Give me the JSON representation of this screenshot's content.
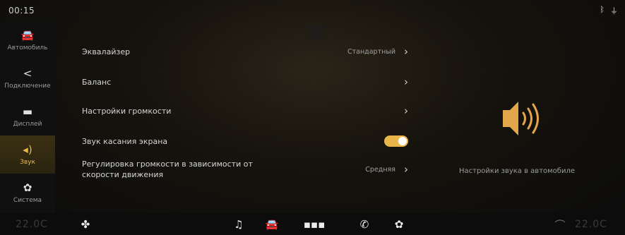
{
  "status": {
    "time": "00:15",
    "icons": [
      "bluetooth-icon",
      "usb-icon"
    ]
  },
  "sidebar": {
    "items": [
      {
        "label": "Автомобиль",
        "icon": "car-icon"
      },
      {
        "label": "Подключение",
        "icon": "share-icon"
      },
      {
        "label": "Дисплей",
        "icon": "display-icon"
      },
      {
        "label": "Звук",
        "icon": "speaker-icon",
        "active": true
      },
      {
        "label": "Система",
        "icon": "gear-icon"
      }
    ]
  },
  "settings": {
    "equalizer": {
      "label": "Эквалайзер",
      "value": "Стандартный"
    },
    "balance": {
      "label": "Баланс"
    },
    "volume_settings": {
      "label": "Настройки громкости"
    },
    "touch_sound": {
      "label": "Звук касания экрана",
      "enabled": true
    },
    "speed_volume": {
      "label_line1": "Регулировка громкости в зависимости от",
      "label_line2": "скорости движения",
      "value": "Средняя"
    }
  },
  "panel": {
    "caption": "Настройки звука в автомобиле",
    "icon": "speaker-icon"
  },
  "dock": {
    "temp_left": "22.0C",
    "temp_right": "22.0C",
    "items": [
      "fan-icon",
      "music-icon",
      "car-icon",
      "apps-icon",
      "phone-icon",
      "gear-icon",
      "seat-icon"
    ]
  },
  "colors": {
    "accent": "#e8b94a",
    "background": "#0b0b0b"
  }
}
